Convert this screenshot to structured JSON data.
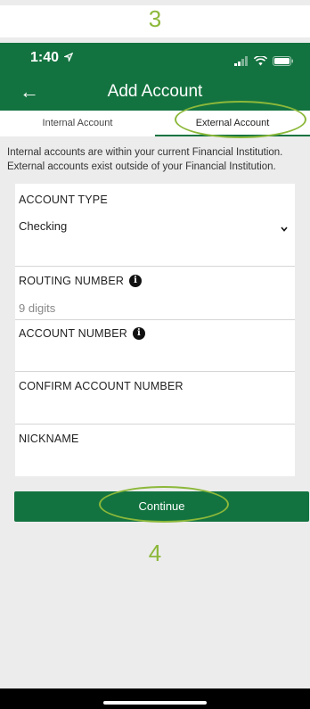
{
  "annotations": {
    "top_step": "3",
    "bottom_step": "4"
  },
  "colors": {
    "brand_green": "#137340",
    "annotation": "#8cb83a",
    "status_white": "#ffffff"
  },
  "status_bar": {
    "time": "1:40",
    "icons": [
      "location-arrow-icon",
      "signal-bars-icon",
      "wifi-icon",
      "battery-icon"
    ]
  },
  "nav": {
    "back_icon": "back-arrow-icon",
    "title": "Add Account"
  },
  "tabs": [
    {
      "label": "Internal Account",
      "selected": false
    },
    {
      "label": "External Account",
      "selected": true
    }
  ],
  "info_text": "Internal accounts are within your current Financial Institution. External accounts exist outside of your Financial Institution.",
  "form": {
    "account_type": {
      "label": "ACCOUNT TYPE",
      "value": "Checking"
    },
    "routing_number": {
      "label": "ROUTING NUMBER",
      "placeholder": "9 digits"
    },
    "account_number": {
      "label": "ACCOUNT NUMBER"
    },
    "confirm_account_number": {
      "label": "CONFIRM ACCOUNT NUMBER"
    },
    "nickname": {
      "label": "NICKNAME"
    }
  },
  "continue_label": "Continue"
}
